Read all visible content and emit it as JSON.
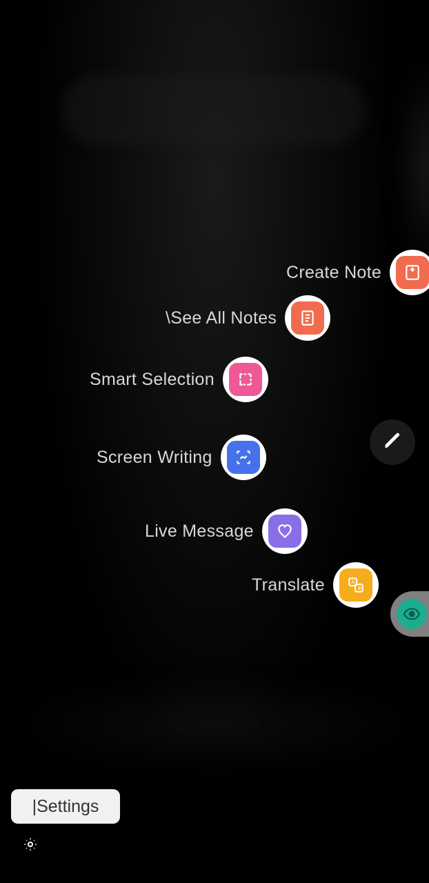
{
  "menu": {
    "items": [
      {
        "label": "Create Note",
        "color": "#f16b4e",
        "icon": "create-note"
      },
      {
        "label": "\\See All Notes",
        "color": "#f16b4e",
        "icon": "see-all-notes"
      },
      {
        "label": "Smart Selection",
        "color": "#ed5895",
        "icon": "smart-selection"
      },
      {
        "label": "Screen Writing",
        "color": "#4771eb",
        "icon": "screen-writing"
      },
      {
        "label": "Live Message",
        "color": "#8a6ee8",
        "icon": "live-message"
      },
      {
        "label": "Translate",
        "color": "#f7ac1e",
        "icon": "translate"
      }
    ]
  },
  "settings": {
    "label": "|Settings"
  },
  "fab": {
    "pen": "pen-icon",
    "eye": "eye-icon",
    "gear": "gear-icon"
  }
}
